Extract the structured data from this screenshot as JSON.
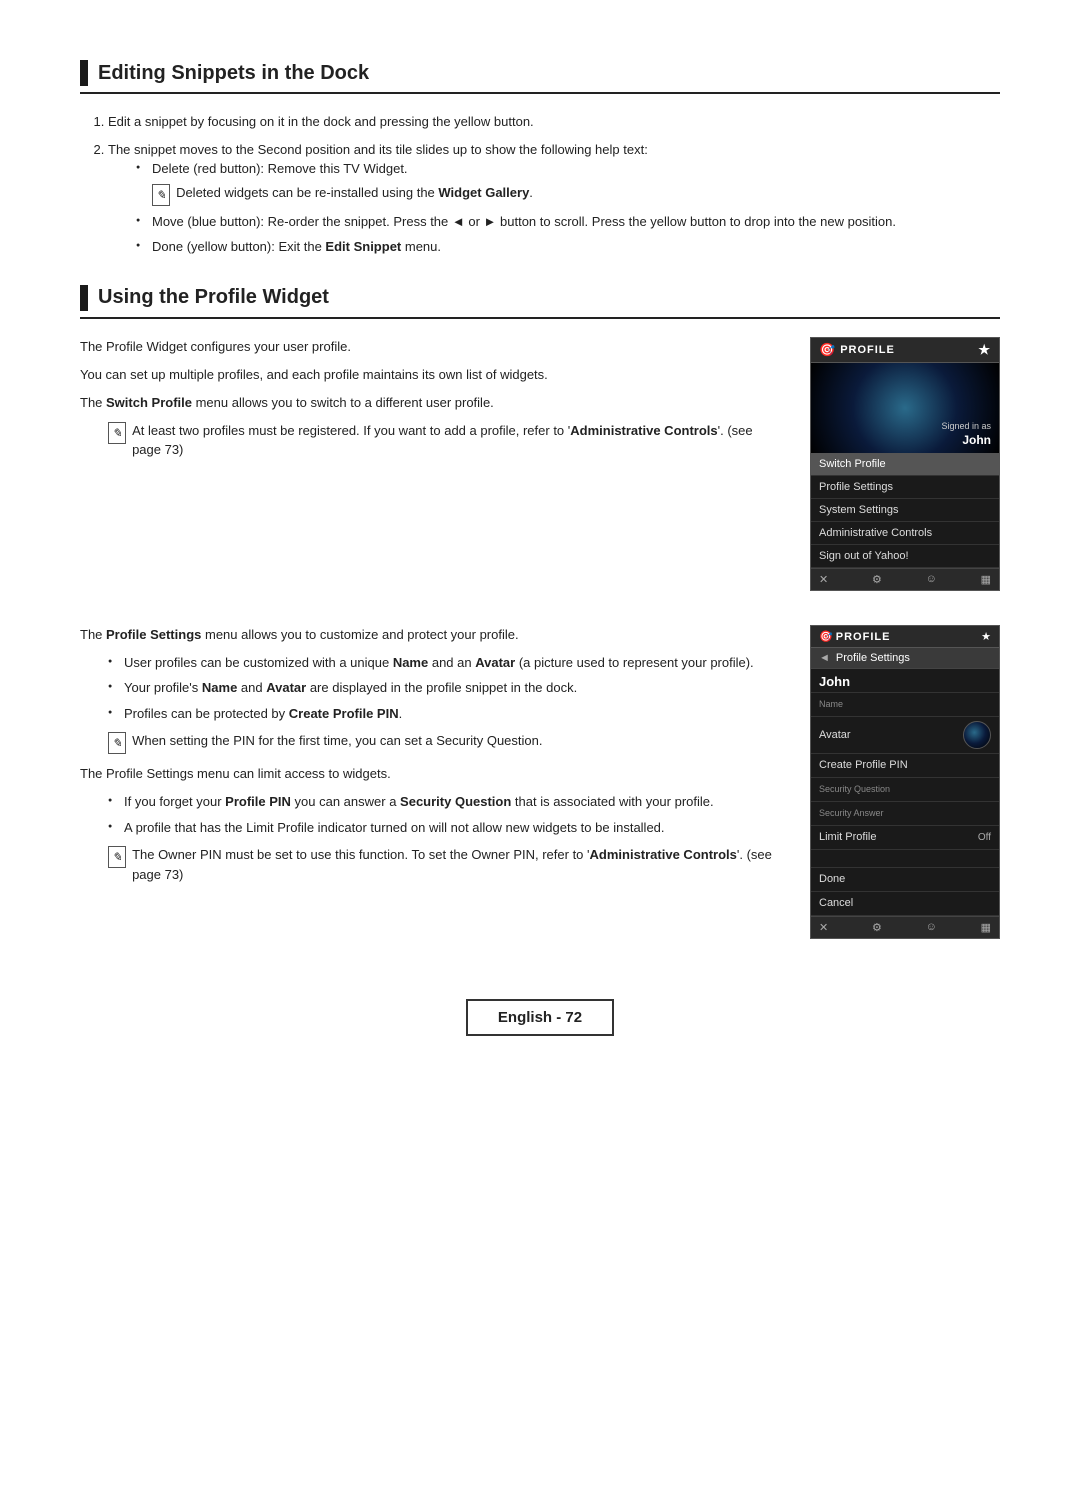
{
  "section1": {
    "heading": "Editing Snippets in the Dock",
    "steps": [
      "Edit a snippet by focusing on it in the dock and pressing the yellow button.",
      "The snippet moves to the Second position and its tile slides up to show the following help text:"
    ],
    "bullets": [
      "Delete (red button): Remove this TV Widget.",
      "Move (blue button): Re-order the snippet. Press the ◄ or ► button to scroll. Press the yellow button to drop into the new position.",
      "Done (yellow button): Exit the Edit Snippet menu."
    ],
    "note_delete": "Deleted widgets can be re-installed using the Widget Gallery."
  },
  "section2": {
    "heading": "Using the Profile Widget",
    "para1": "The Profile Widget configures your user profile.",
    "para2": "You can set up multiple profiles, and each profile maintains its own list of widgets.",
    "para3": "The Switch Profile menu allows you to switch to a different user profile.",
    "note1": "At least two profiles must be registered. If you want to add a profile, refer to 'Administrative Controls'. (see page 73)",
    "widget1": {
      "header_icon": "🎯",
      "header_title": "PROFILE",
      "star": "★",
      "signed_in_as": "Signed in as",
      "user_name": "John",
      "menu_items": [
        {
          "label": "Switch Profile",
          "highlighted": true
        },
        {
          "label": "Profile Settings",
          "highlighted": false
        },
        {
          "label": "System Settings",
          "highlighted": false
        },
        {
          "label": "Administrative Controls",
          "highlighted": false
        },
        {
          "label": "Sign out of Yahoo!",
          "highlighted": false
        }
      ],
      "footer_icons": [
        "✕",
        "⚙",
        "☺",
        "▦"
      ]
    },
    "para_settings": "The Profile Settings menu allows you to customize and protect your profile.",
    "bullets2": [
      "User profiles can be customized with a unique Name and an Avatar (a picture used to represent your profile).",
      "Your profile's Name and Avatar are displayed in the profile snippet in the dock.",
      "Profiles can be protected by Create Profile PIN."
    ],
    "note2": "When setting the PIN for the first time, you can set a Security Question.",
    "para_limit": "The Profile Settings menu can limit access to widgets.",
    "bullets3": [
      "If you forget your Profile PIN you can answer a Security Question that is associated with your profile.",
      "A profile that has the Limit Profile indicator turned on will not allow new widgets to be installed."
    ],
    "note3": "The Owner PIN must be set to use this function. To set the Owner PIN, refer to 'Administrative Controls'. (see page 73)",
    "widget2": {
      "header_title": "PROFILE",
      "header_icon": "🎯",
      "star": "★",
      "nav_back": "◄",
      "nav_label": "Profile Settings",
      "user_name": "John",
      "name_label": "Name",
      "avatar_label": "Avatar",
      "create_pin_label": "Create Profile PIN",
      "security_q_label": "Security Question",
      "security_a_label": "Security Answer",
      "limit_profile_label": "Limit Profile",
      "limit_profile_value": "Off",
      "done_label": "Done",
      "cancel_label": "Cancel",
      "footer_icons": [
        "✕",
        "⚙",
        "☺",
        "▦"
      ]
    }
  },
  "footer": {
    "label": "English - 72"
  }
}
